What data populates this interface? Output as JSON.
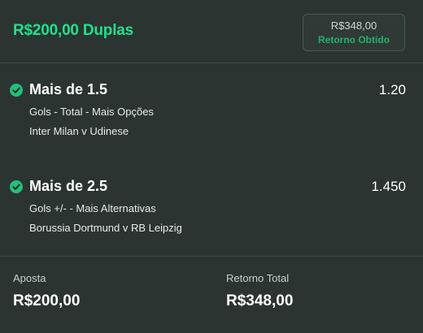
{
  "header": {
    "title": "R$200,00 Duplas",
    "return_amount": "R$348,00",
    "return_label": "Retorno Obtido"
  },
  "selections": [
    {
      "name": "Mais de 1.5",
      "odds": "1.20",
      "market": "Gols - Total - Mais Opções",
      "event": "Inter Milan v Udinese",
      "status_icon": "check-circle-icon"
    },
    {
      "name": "Mais de 2.5",
      "odds": "1.450",
      "market": "Gols +/- - Mais Alternativas",
      "event": "Borussia Dortmund v RB Leipzig",
      "status_icon": "check-circle-icon"
    }
  ],
  "footer": {
    "stake_label": "Aposta",
    "stake_value": "R$200,00",
    "total_return_label": "Retorno Total",
    "total_return_value": "R$348,00"
  },
  "colors": {
    "background": "#2b3431",
    "accent": "#22e08a",
    "won_green": "#1fb36e",
    "divider": "#3e4844"
  }
}
